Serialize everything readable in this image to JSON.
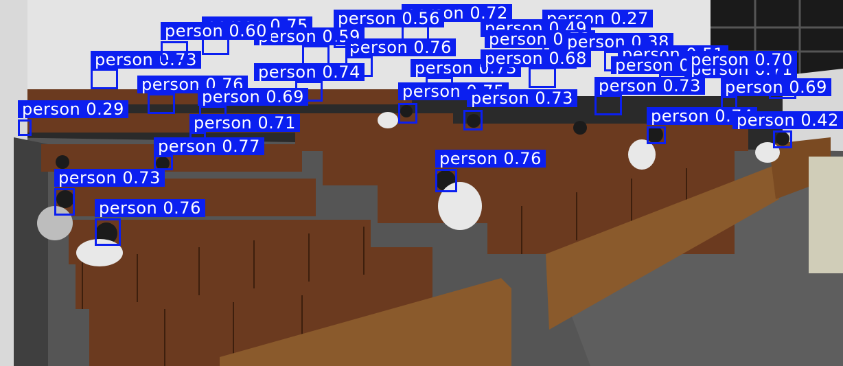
{
  "image": {
    "subject": "classroom-surveillance-frame",
    "colors": {
      "box": "#0b1ff0",
      "label_text": "#ffffff",
      "wood": "#6b3a1f",
      "floor": "#4a4a4a",
      "wall": "#e6e6e6"
    }
  },
  "detections": [
    {
      "label": "person",
      "score": "0.75"
    },
    {
      "label": "person",
      "score": "0.72"
    },
    {
      "label": "person",
      "score": "0.27"
    },
    {
      "label": "person",
      "score": "0.49"
    },
    {
      "label": "person",
      "score": "0.59"
    },
    {
      "label": "person",
      "score": "0.76"
    },
    {
      "label": "person",
      "score": "0.73"
    },
    {
      "label": "person",
      "score": "0.38"
    },
    {
      "label": "person",
      "score": "0.73"
    },
    {
      "label": "person",
      "score": "0.74"
    },
    {
      "label": "person",
      "score": "0.73"
    },
    {
      "label": "person",
      "score": "0.68"
    },
    {
      "label": "person",
      "score": "0.51"
    },
    {
      "label": "person",
      "score": "0.72"
    },
    {
      "label": "person",
      "score": "0.71"
    },
    {
      "label": "person",
      "score": "0.70"
    },
    {
      "label": "person",
      "score": "0.76"
    },
    {
      "label": "person",
      "score": "0.69"
    },
    {
      "label": "person",
      "score": "0.75"
    },
    {
      "label": "person",
      "score": "0.73"
    },
    {
      "label": "person",
      "score": "0.73"
    },
    {
      "label": "person",
      "score": "0.69"
    },
    {
      "label": "person",
      "score": "0.29"
    },
    {
      "label": "person",
      "score": "0.71"
    },
    {
      "label": "person",
      "score": "0.74"
    },
    {
      "label": "person",
      "score": "0.42"
    },
    {
      "label": "person",
      "score": "0.77"
    },
    {
      "label": "person",
      "score": "0.76"
    },
    {
      "label": "person",
      "score": "0.73"
    },
    {
      "label": "person",
      "score": "0.76"
    },
    {
      "label": "person",
      "score": "0.60"
    },
    {
      "label": "person",
      "score": "0.56"
    }
  ]
}
